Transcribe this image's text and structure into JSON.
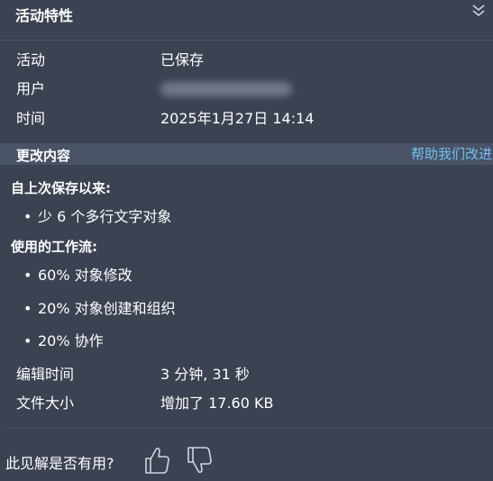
{
  "header": {
    "title": "活动特性",
    "collapse_icon": "chevron-double-down-icon"
  },
  "details": [
    {
      "label": "活动",
      "value": "已保存"
    },
    {
      "label": "用户",
      "value": ""
    },
    {
      "label": "时间",
      "value": "2025年1月27日 14:14"
    }
  ],
  "changes": {
    "title": "更改内容",
    "help_link": "帮助我们改进",
    "since_last_save_heading": "自上次保存以来:",
    "since_last_save_items": [
      "少 6 个多行文字对象"
    ],
    "workflow_heading": "使用的工作流:",
    "workflow_items": [
      "60% 对象修改",
      "20% 对象创建和组织",
      "20% 协作"
    ]
  },
  "stats": [
    {
      "label": "编辑时间",
      "value": "3 分钟, 31 秒"
    },
    {
      "label": "文件大小",
      "value": "增加了 17.60 KB"
    }
  ],
  "feedback": {
    "question": "此见解是否有用?",
    "thumbs_up_icon": "thumbs-up-icon",
    "thumbs_down_icon": "thumbs-down-icon"
  },
  "colors": {
    "background": "#3b4252",
    "section_bar": "#4a5266",
    "link": "#6ec1ef",
    "text": "#ffffff"
  }
}
